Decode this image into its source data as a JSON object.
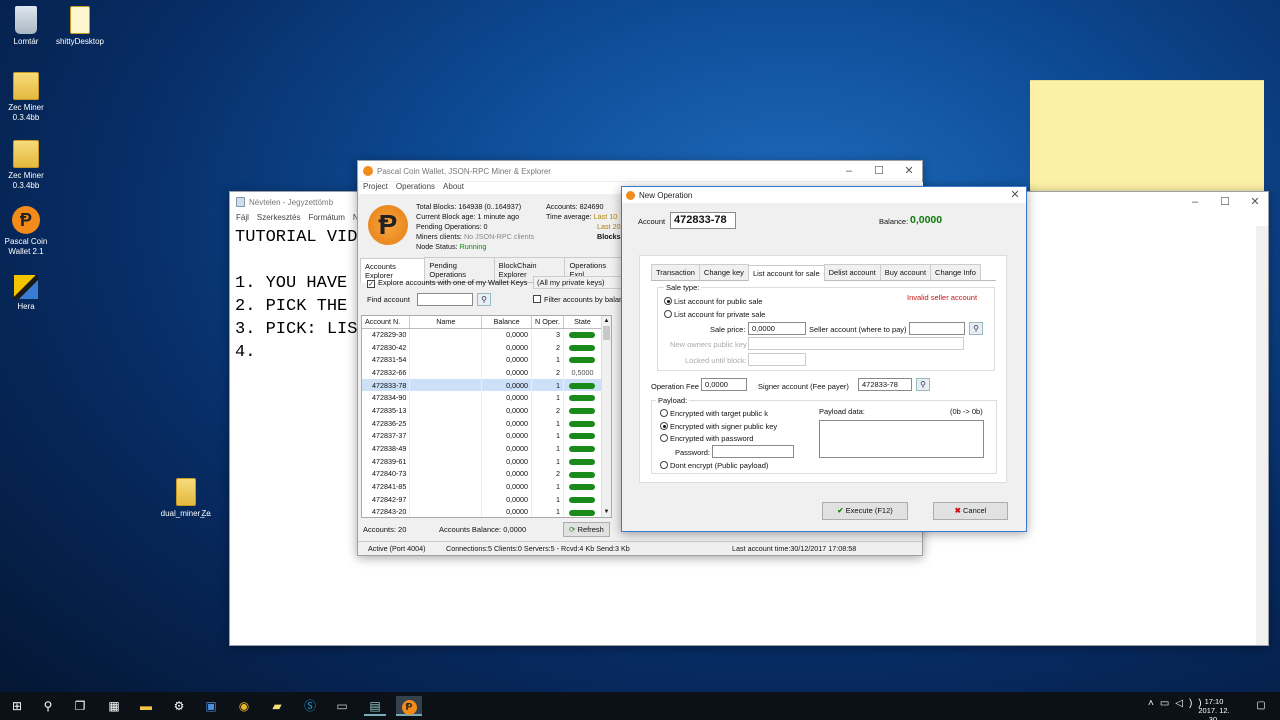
{
  "desktop": {
    "icons": [
      {
        "label": "Lomtár",
        "icon": "recycle-bin-icon"
      },
      {
        "label": "shittyDesktop",
        "icon": "document-icon"
      },
      {
        "label": "Zec Miner 0.3.4bb",
        "icon": "folder-zip-icon"
      },
      {
        "label": "Zec Miner 0.3.4bb",
        "icon": "folder-zip-icon"
      },
      {
        "label": "Pascal Coin Wallet 2.1",
        "icon": "pascal-coin-icon"
      },
      {
        "label": "Hera",
        "icon": "hera-icon"
      },
      {
        "label": "dual_miner_...",
        "icon": "folder-icon"
      },
      {
        "label": "Ze",
        "icon": "folder-icon"
      }
    ]
  },
  "notepad": {
    "title": "Névtelen - Jegyzettömb",
    "menu": [
      "Fájl",
      "Szerkesztés",
      "Formátum",
      "N"
    ],
    "lines": [
      "TUTORIAL VID",
      "",
      "1. YOU HAVE",
      "2. PICK THE",
      "3. PICK: LIS",
      "4."
    ]
  },
  "wallet": {
    "title": "Pascal Coin Wallet, JSON-RPC Miner & Explorer",
    "menu": [
      "Project",
      "Operations",
      "About"
    ],
    "stats": [
      {
        "label": "Total Blocks:",
        "value": "164938 (0..164937)"
      },
      {
        "label": "Current Block age:",
        "value": "1 minute ago"
      },
      {
        "label": "Pending Operations:",
        "value": "0"
      },
      {
        "label": "Miners clients:",
        "value": "No JSON-RPC clients"
      },
      {
        "label": "Node Status:",
        "value": "Running"
      }
    ],
    "stats2": [
      {
        "label": "Accounts:",
        "value": "824690"
      },
      {
        "label": "Time average:",
        "value": "Last 10"
      },
      {
        "label": "",
        "value": "Last 20"
      },
      {
        "label": "",
        "value": "Blocks"
      }
    ],
    "tabs": [
      "Accounts Explorer",
      "Pending Operations",
      "BlockChain Explorer",
      "Operations Expl"
    ],
    "explore_checkbox": "Explore accounts with one of my Wallet Keys",
    "keys_select": "(All my private keys)",
    "find_label": "Find account",
    "filter_checkbox": "Filter accounts by balanc",
    "columns": [
      "Account N.",
      "Name",
      "Balance",
      "N Oper.",
      "State"
    ],
    "rows": [
      {
        "account": "472829-30",
        "name": "",
        "balance": "0,0000",
        "ops": "3",
        "state": ""
      },
      {
        "account": "472830-42",
        "name": "",
        "balance": "0,0000",
        "ops": "2",
        "state": ""
      },
      {
        "account": "472831-54",
        "name": "",
        "balance": "0,0000",
        "ops": "1",
        "state": ""
      },
      {
        "account": "472832-66",
        "name": "",
        "balance": "0,0000",
        "ops": "2",
        "state": "0,5000"
      },
      {
        "account": "472833-78",
        "name": "",
        "balance": "0,0000",
        "ops": "1",
        "state": ""
      },
      {
        "account": "472834-90",
        "name": "",
        "balance": "0,0000",
        "ops": "1",
        "state": ""
      },
      {
        "account": "472835-13",
        "name": "",
        "balance": "0,0000",
        "ops": "2",
        "state": ""
      },
      {
        "account": "472836-25",
        "name": "",
        "balance": "0,0000",
        "ops": "1",
        "state": ""
      },
      {
        "account": "472837-37",
        "name": "",
        "balance": "0,0000",
        "ops": "1",
        "state": ""
      },
      {
        "account": "472838-49",
        "name": "",
        "balance": "0,0000",
        "ops": "1",
        "state": ""
      },
      {
        "account": "472839-61",
        "name": "",
        "balance": "0,0000",
        "ops": "1",
        "state": ""
      },
      {
        "account": "472840-73",
        "name": "",
        "balance": "0,0000",
        "ops": "2",
        "state": ""
      },
      {
        "account": "472841-85",
        "name": "",
        "balance": "0,0000",
        "ops": "1",
        "state": ""
      },
      {
        "account": "472842-97",
        "name": "",
        "balance": "0,0000",
        "ops": "1",
        "state": ""
      },
      {
        "account": "472843-20",
        "name": "",
        "balance": "0,0000",
        "ops": "1",
        "state": ""
      }
    ],
    "selected_row": "472833-78",
    "footer_accounts": "Accounts:  20",
    "footer_balance": "Accounts Balance:  0,0000",
    "refresh_label": "Refresh",
    "status": {
      "active": "Active (Port 4004)",
      "connections": "Connections:5 Clients:0 Servers:5 - Rcvd:4 Kb Send:3 Kb",
      "last_account": "Last account time:30/12/2017 17:08:58"
    }
  },
  "dialog": {
    "title": "New Operation",
    "account_label": "Account",
    "account_value": "472833-78",
    "balance_label": "Balance:",
    "balance_value": "0,0000",
    "tabs": [
      "Transaction",
      "Change key",
      "List account for sale",
      "Delist account",
      "Buy account",
      "Change Info"
    ],
    "sale_type_label": "Sale type:",
    "radio_public": "List account for public sale",
    "radio_private": "List account for private sale",
    "invalid_seller": "Invalid seller account",
    "sale_price_label": "Sale price:",
    "sale_price_value": "0,0000",
    "seller_account_label": "Seller account (where to pay)",
    "seller_account_value": "",
    "new_owner_label": "New owners public key",
    "locked_until_label": "Locked until block:",
    "operation_fee_label": "Operation Fee",
    "operation_fee_value": "0,0000",
    "signer_label": "Signer account (Fee payer)",
    "signer_value": "472833-78",
    "payload_label": "Payload:",
    "payload_options": [
      "Encrypted with target public k",
      "Encrypted with signer public key",
      "Encrypted with password",
      "Dont encrypt (Public payload)"
    ],
    "password_label": "Password:",
    "payload_data_label": "Payload data:",
    "payload_size": "(0b -> 0b)",
    "execute_label": "Execute (F12)",
    "cancel_label": "Cancel"
  },
  "taskbar": {
    "icons": [
      "windows-start-icon",
      "search-icon",
      "task-view-icon",
      "calculator-icon",
      "file-explorer-icon",
      "settings-icon",
      "save-icon",
      "chrome-icon",
      "sticky-notes-icon",
      "skype-icon",
      "terminal-icon",
      "notepad-icon",
      "pascal-coin-icon"
    ],
    "time": "17:10",
    "date": "2017. 12. 30."
  },
  "colors": {
    "accent_green": "#0a7a0a",
    "error_red": "#d01010",
    "selected_row": "#cce0f7"
  }
}
